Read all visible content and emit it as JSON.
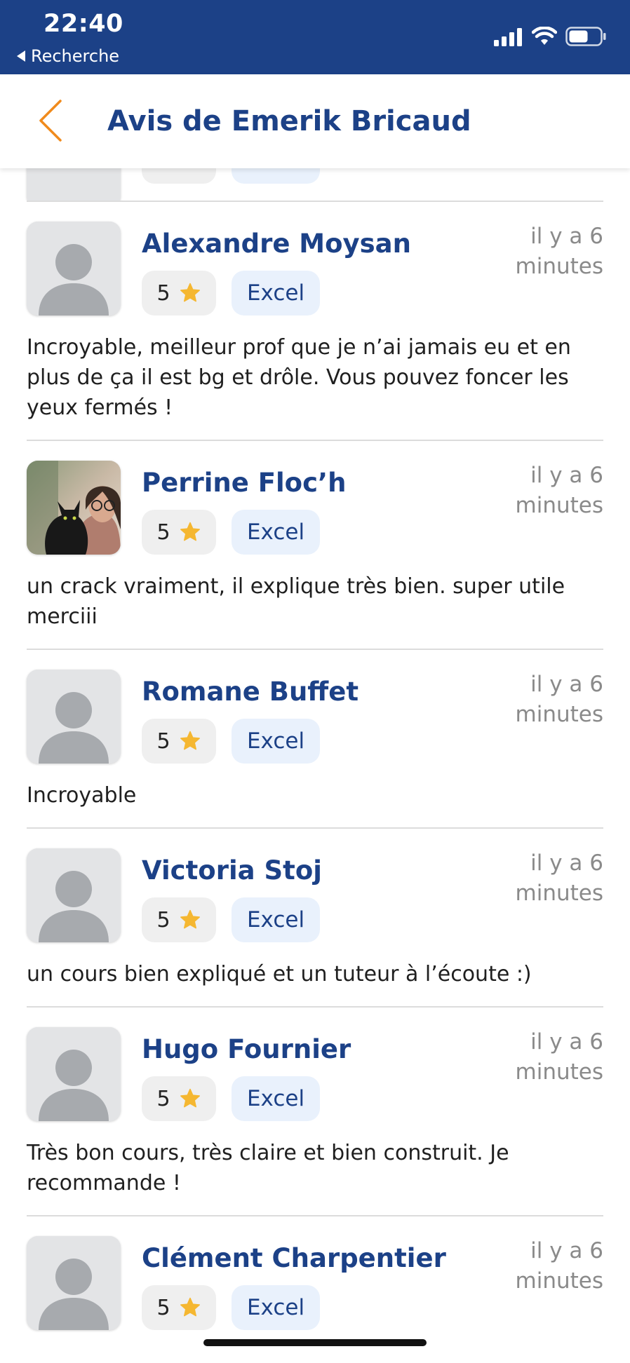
{
  "status_bar": {
    "time": "22:40",
    "back_label": "Recherche"
  },
  "header": {
    "title": "Avis de Emerik Bricaud"
  },
  "colors": {
    "brand_blue": "#1c4187",
    "accent_orange": "#f08a1c",
    "star": "#f5b731"
  },
  "reviews": [
    {
      "name": "Alexandre Moysan",
      "time": "il y a 6 minutes",
      "rating": "5",
      "tag": "Excel",
      "text": "Incroyable, meilleur prof que je n’ai jamais eu et en plus de ça il est bg et drôle. Vous pouvez foncer les yeux fermés !",
      "avatar": "placeholder"
    },
    {
      "name": "Perrine Floc’h",
      "time": "il y a 6 minutes",
      "rating": "5",
      "tag": "Excel",
      "text": "un crack vraiment, il explique très bien. super utile merciii",
      "avatar": "photo"
    },
    {
      "name": "Romane Buffet",
      "time": "il y a 6 minutes",
      "rating": "5",
      "tag": "Excel",
      "text": "Incroyable",
      "avatar": "placeholder"
    },
    {
      "name": "Victoria Stoj",
      "time": "il y a 6 minutes",
      "rating": "5",
      "tag": "Excel",
      "text": "un cours bien expliqué et un tuteur à l’écoute :)",
      "avatar": "placeholder"
    },
    {
      "name": "Hugo Fournier",
      "time": "il y a 6 minutes",
      "rating": "5",
      "tag": "Excel",
      "text": "Très bon cours, très claire et bien construit. Je recommande !",
      "avatar": "placeholder"
    },
    {
      "name": "Clément Charpentier",
      "time": "il y a 6 minutes",
      "rating": "5",
      "tag": "Excel",
      "text": "",
      "avatar": "placeholder"
    }
  ]
}
